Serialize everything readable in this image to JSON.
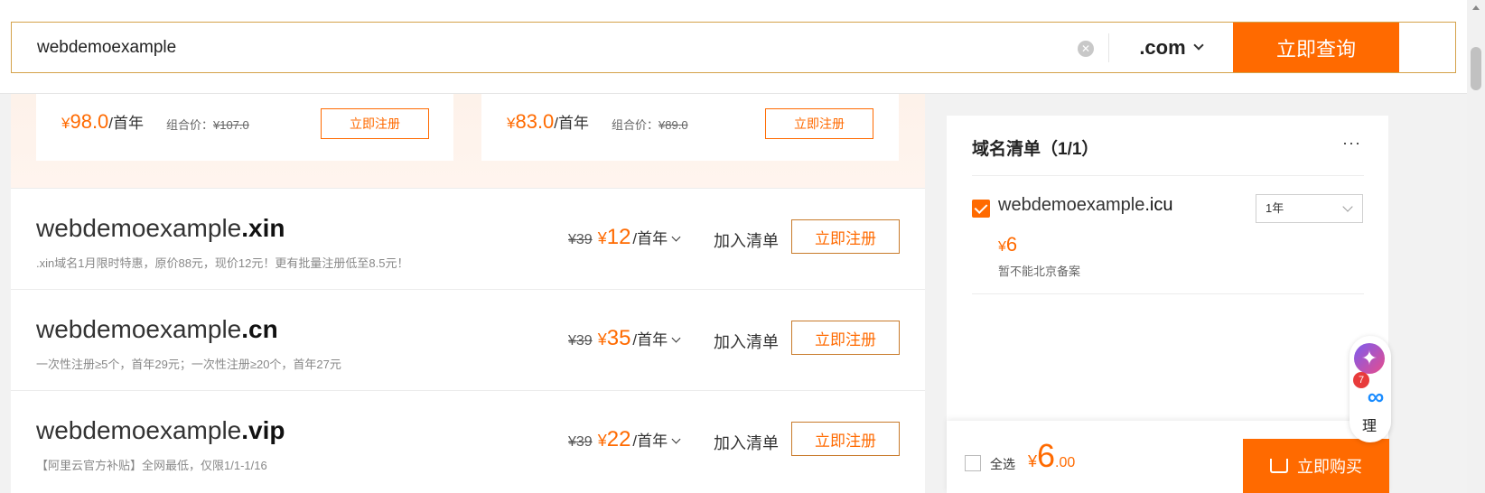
{
  "search": {
    "value": "webdemoexample",
    "clear_icon": "clear-circle-icon",
    "tld": ".com",
    "button": "立即查询"
  },
  "combos": [
    {
      "currency": "¥",
      "price": "98.0",
      "unit": "/首年",
      "orig_label": "组合价：",
      "orig_price": "¥107.0",
      "register": "立即注册"
    },
    {
      "currency": "¥",
      "price": "83.0",
      "unit": "/首年",
      "orig_label": "组合价：",
      "orig_price": "¥89.0",
      "register": "立即注册"
    }
  ],
  "domains": [
    {
      "base": "webdemoexample",
      "tld": ".xin",
      "desc": ".xin域名1月限时特惠，原价88元，现价12元！更有批量注册低至8.5元！",
      "orig": "¥39",
      "currency": "¥",
      "price": "12",
      "per": "/首年",
      "add": "加入清单",
      "register": "立即注册"
    },
    {
      "base": "webdemoexample",
      "tld": ".cn",
      "desc": "一次性注册≥5个，首年29元；一次性注册≥20个，首年27元",
      "orig": "¥39",
      "currency": "¥",
      "price": "35",
      "per": "/首年",
      "add": "加入清单",
      "register": "立即注册"
    },
    {
      "base": "webdemoexample",
      "tld": ".vip",
      "desc": "【阿里云官方补贴】全网最低，仅限1/1-1/16",
      "orig": "¥39",
      "currency": "¥",
      "price": "22",
      "per": "/首年",
      "add": "加入清单",
      "register": "立即注册"
    }
  ],
  "cart": {
    "title": "域名清单（1/1）",
    "more": "···",
    "item": {
      "base": "webdemoexample",
      "tld": ".icu",
      "year": "1年",
      "currency": "¥",
      "price": "6",
      "note": "暂不能北京备案"
    },
    "select_all": "全选",
    "total_currency": "¥",
    "total_int": "6",
    "total_dec": ".00",
    "buy": "立即购买"
  },
  "float": {
    "badge": "7",
    "label": "理"
  },
  "colors": {
    "accent": "#ff6a00",
    "border_gold": "#d4a24a"
  }
}
